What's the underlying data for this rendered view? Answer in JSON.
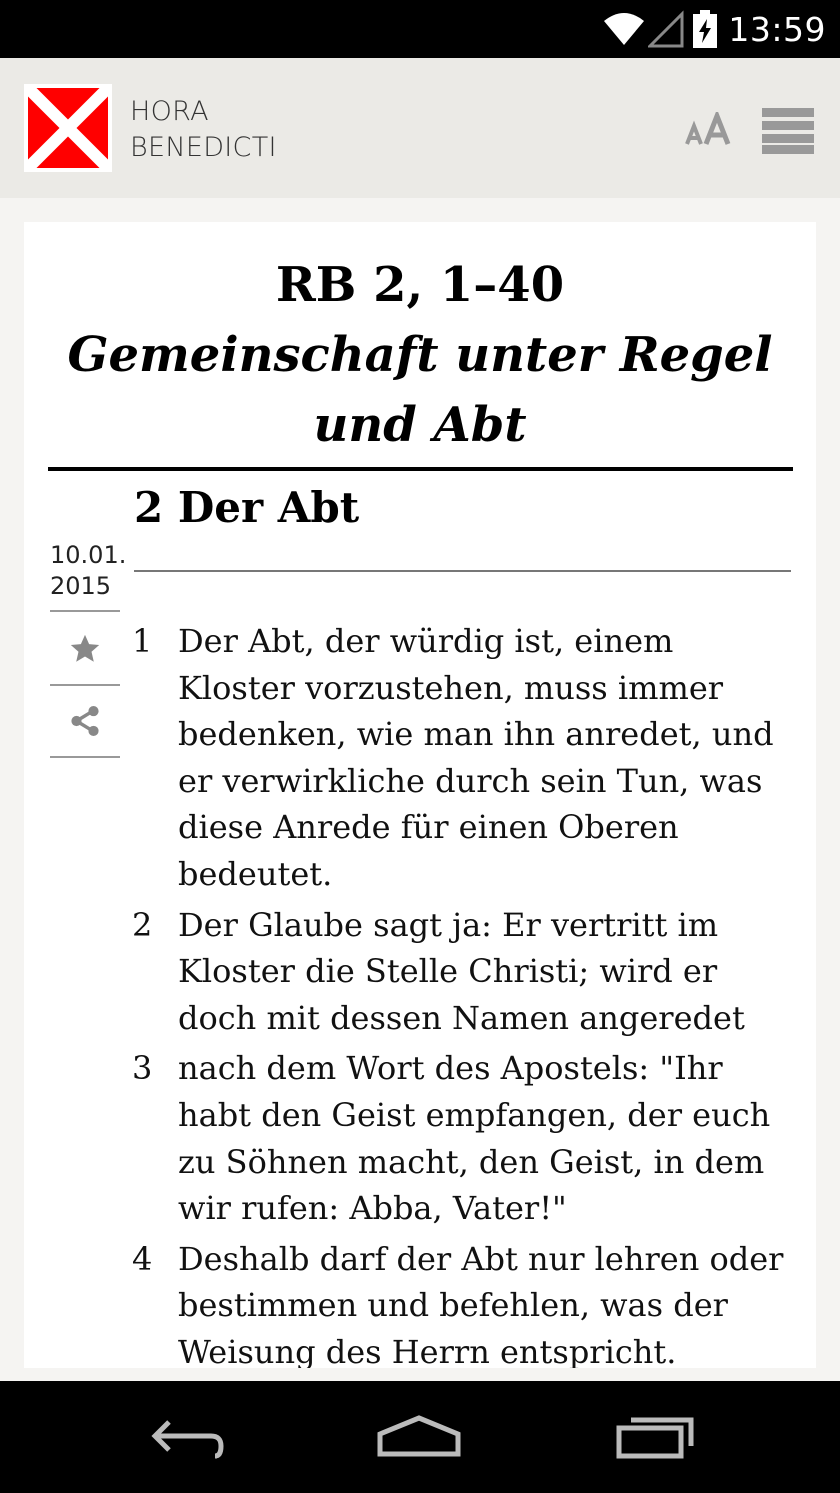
{
  "status_bar": {
    "time": "13:59"
  },
  "app": {
    "title_line1": "HORA",
    "title_line2": "BENEDICTI",
    "brand_color": "#ff0000"
  },
  "reading": {
    "reference": "RB 2, 1–40",
    "subtitle_line1": "Gemeinschaft unter Regel",
    "subtitle_line2": "und Abt",
    "chapter": "2 Der Abt",
    "date_line1": "10.01.",
    "date_line2": "2015",
    "verses": [
      {
        "num": "1",
        "text": "Der Abt, der würdig ist, einem Kloster vorzustehen, muss immer bedenken, wie man ihn anredet, und er verwirkliche durch sein Tun, was diese Anrede für einen Oberen bedeutet."
      },
      {
        "num": "2",
        "text": "Der Glaube sagt ja: Er vertritt im Kloster die Stelle Christi; wird er doch mit dessen Namen angeredet"
      },
      {
        "num": "3",
        "text": "nach dem Wort des Apostels: \"Ihr habt den Geist empfangen, der euch zu Söhnen macht, den Geist, in dem wir rufen: Abba, Vater!\""
      },
      {
        "num": "4",
        "text": "Deshalb darf der Abt nur lehren oder bestimmen und befehlen, was der Weisung des Herrn entspricht."
      }
    ]
  }
}
